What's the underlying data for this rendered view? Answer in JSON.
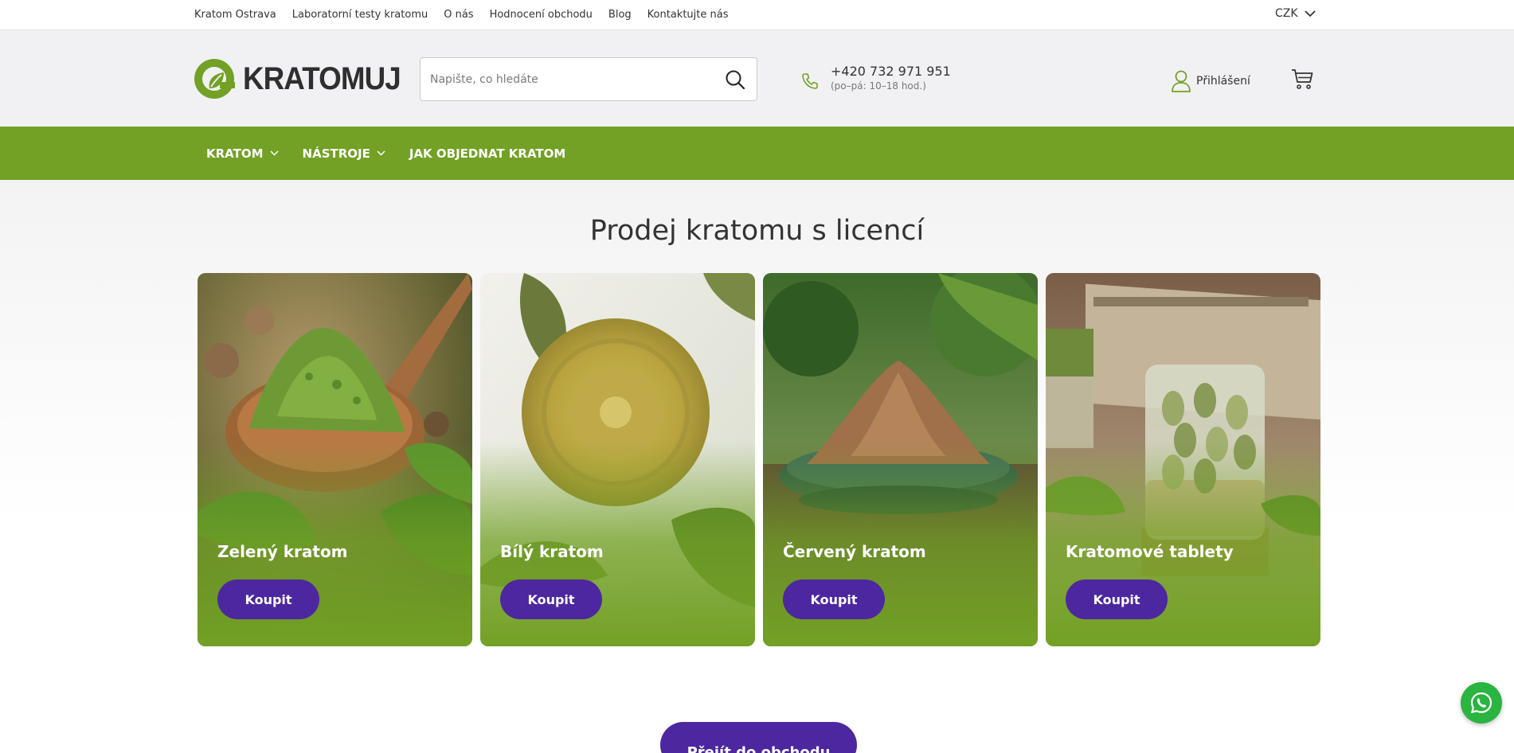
{
  "topbar": {
    "links": [
      "Kratom Ostrava",
      "Laboratorní testy kratomu",
      "O nás",
      "Hodnocení obchodu",
      "Blog",
      "Kontaktujte nás"
    ],
    "currency": "CZK"
  },
  "header": {
    "logo_text": "KRATOMUJ",
    "search_placeholder": "Napište, co hledáte",
    "phone": "+420 732 971 951",
    "phone_hours": "(po–pá: 10–18 hod.)",
    "login_label": "Přihlášení"
  },
  "nav": {
    "items": [
      {
        "label": "KRATOM",
        "has_dropdown": true
      },
      {
        "label": "NÁSTROJE",
        "has_dropdown": true
      },
      {
        "label": "JAK OBJEDNAT KRATOM",
        "has_dropdown": false
      }
    ]
  },
  "main": {
    "title": "Prodej kratomu s licencí",
    "cards": [
      {
        "name": "Zelený kratom",
        "button": "Koupit"
      },
      {
        "name": "Bílý kratom",
        "button": "Koupit"
      },
      {
        "name": "Červený kratom",
        "button": "Koupit"
      },
      {
        "name": "Kratomové tablety",
        "button": "Koupit"
      }
    ],
    "cta": "Přejít do obchodu"
  },
  "colors": {
    "brand_green": "#72a125",
    "button_purple": "#4d27a0",
    "whatsapp_green": "#2ab440"
  },
  "icons": [
    "chevron-down-icon",
    "search-icon",
    "phone-icon",
    "user-icon",
    "cart-icon",
    "whatsapp-icon"
  ]
}
